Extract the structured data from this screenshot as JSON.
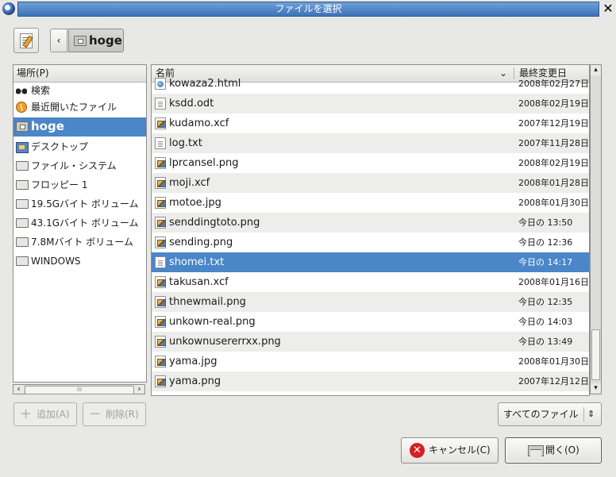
{
  "window": {
    "title": "ファイルを選択",
    "close_glyph": "✕"
  },
  "pathbar": {
    "back_glyph": "‹",
    "current_folder": "hoge"
  },
  "places": {
    "header": "場所(P)",
    "items": [
      {
        "label": "検索",
        "icon": "binoculars-icon"
      },
      {
        "label": "最近開いたファイル",
        "icon": "recent-icon"
      },
      {
        "label": "hoge",
        "icon": "folder-icon",
        "selected": true
      },
      {
        "label": "デスクトップ",
        "icon": "desktop-icon"
      },
      {
        "label": "ファイル・システム",
        "icon": "drive-icon"
      },
      {
        "label": "フロッピー 1",
        "icon": "floppy-icon"
      },
      {
        "label": "19.5Gバイト ボリューム",
        "icon": "drive-icon"
      },
      {
        "label": "43.1Gバイト ボリューム",
        "icon": "drive-icon"
      },
      {
        "label": "7.8Mバイト ボリューム",
        "icon": "drive-icon"
      },
      {
        "label": "WINDOWS",
        "icon": "drive-icon"
      }
    ],
    "hscroll_thumb": "III"
  },
  "buttons": {
    "add": "追加(A)",
    "remove": "削除(R)",
    "cancel": "キャンセル(C)",
    "open": "開く(O)"
  },
  "files": {
    "col_name": "名前",
    "col_modified": "最終変更日",
    "rows": [
      {
        "name": "kowaza2.html",
        "date": "2008年02月27日",
        "type": "html"
      },
      {
        "name": "ksdd.odt",
        "date": "2008年02月19日",
        "type": "txt"
      },
      {
        "name": "kudamo.xcf",
        "date": "2007年12月19日",
        "type": "img"
      },
      {
        "name": "log.txt",
        "date": "2007年11月28日",
        "type": "txt"
      },
      {
        "name": "lprcansel.png",
        "date": "2008年02月19日",
        "type": "img"
      },
      {
        "name": "moji.xcf",
        "date": "2008年01月28日",
        "type": "img"
      },
      {
        "name": "motoe.jpg",
        "date": "2008年01月30日",
        "type": "img"
      },
      {
        "name": "senddingtoto.png",
        "date": "今日の 13:50",
        "type": "img"
      },
      {
        "name": "sending.png",
        "date": "今日の 12:36",
        "type": "img"
      },
      {
        "name": "shomei.txt",
        "date": "今日の 14:17",
        "type": "txt",
        "selected": true
      },
      {
        "name": "takusan.xcf",
        "date": "2008年01月16日",
        "type": "img"
      },
      {
        "name": "thnewmail.png",
        "date": "今日の 12:35",
        "type": "img"
      },
      {
        "name": "unkown-real.png",
        "date": "今日の 14:03",
        "type": "img"
      },
      {
        "name": "unkownusererrxx.png",
        "date": "今日の 13:49",
        "type": "img"
      },
      {
        "name": "yama.jpg",
        "date": "2008年01月30日",
        "type": "img"
      },
      {
        "name": "yama.png",
        "date": "2007年12月12日",
        "type": "img"
      }
    ]
  },
  "filter": {
    "selected": "すべてのファイル"
  }
}
